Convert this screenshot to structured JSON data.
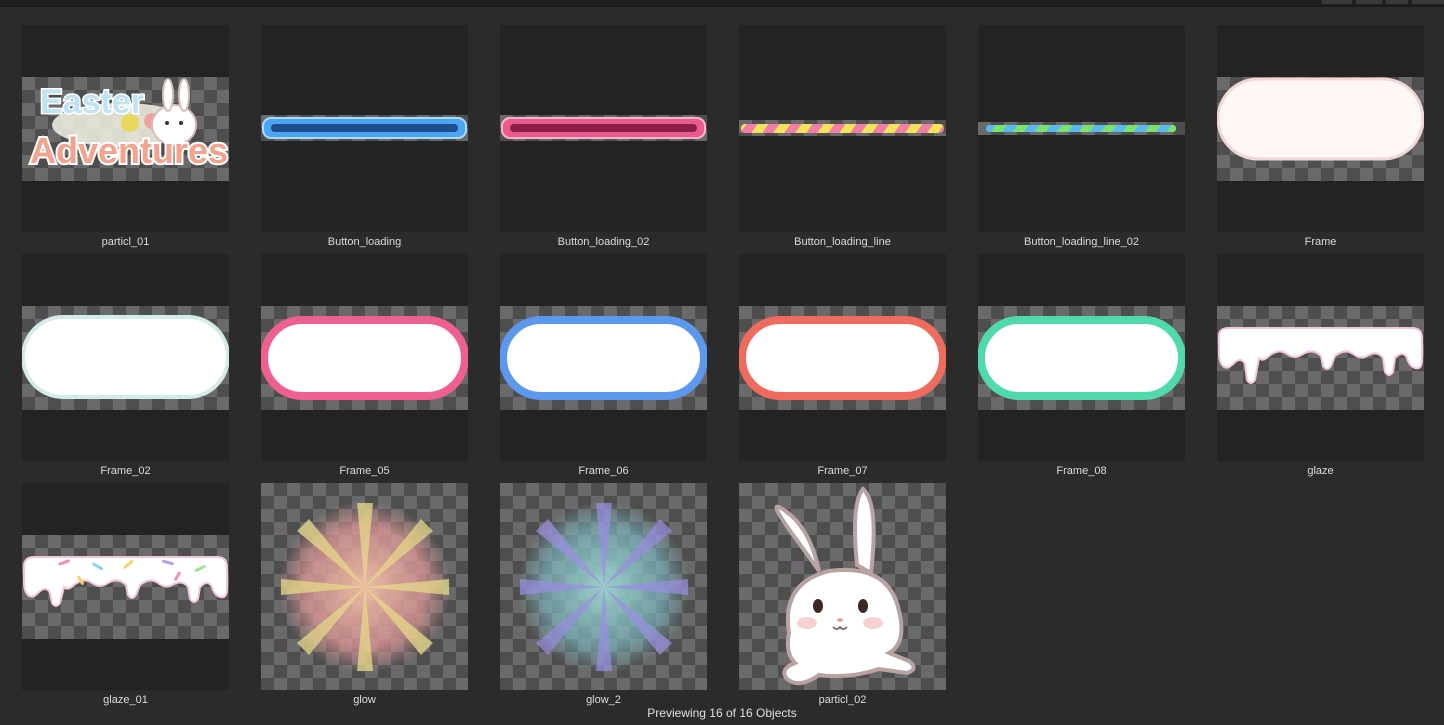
{
  "assets": [
    {
      "name": "particl_01"
    },
    {
      "name": "Button_loading"
    },
    {
      "name": "Button_loading_02"
    },
    {
      "name": "Button_loading_line"
    },
    {
      "name": "Button_loading_line_02"
    },
    {
      "name": "Frame"
    },
    {
      "name": "Frame_02"
    },
    {
      "name": "Frame_05"
    },
    {
      "name": "Frame_06"
    },
    {
      "name": "Frame_07"
    },
    {
      "name": "Frame_08"
    },
    {
      "name": "glaze"
    },
    {
      "name": "glaze_01"
    },
    {
      "name": "glow"
    },
    {
      "name": "glow_2"
    },
    {
      "name": "particl_02"
    }
  ],
  "logo": {
    "line1": "Easter",
    "line2": "Adventures"
  },
  "footer": {
    "status": "Previewing 16 of 16 Objects"
  }
}
